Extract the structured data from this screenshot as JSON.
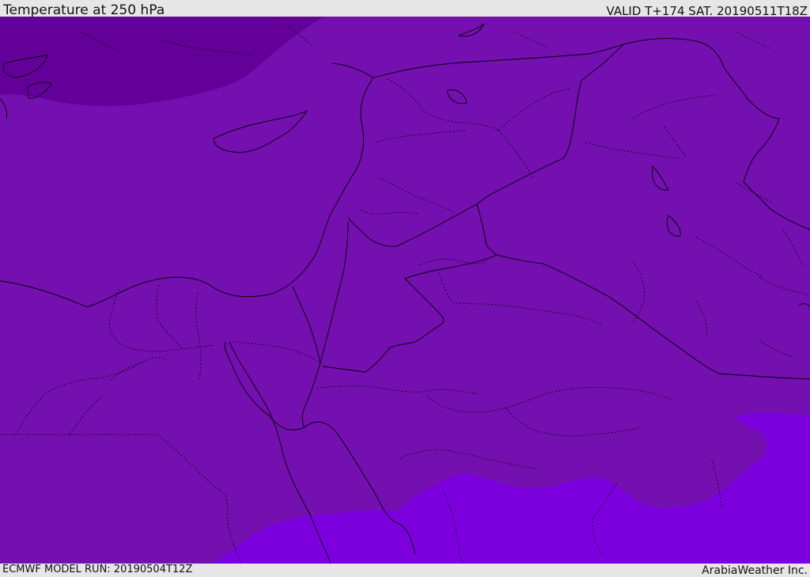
{
  "header": {
    "title": "Temperature at 250 hPa",
    "valid": "VALID T+174 SAT. 20190511T18Z"
  },
  "footer": {
    "model_run": "ECMWF MODEL RUN: 20190504T12Z",
    "credit": "ArabiaWeather Inc."
  },
  "map": {
    "field": "temperature",
    "level": "250 hPa",
    "colors": {
      "base": "#7410b0",
      "cold_north": "#64009a",
      "warm_south": "#7c00dd",
      "border": "#000000"
    }
  }
}
